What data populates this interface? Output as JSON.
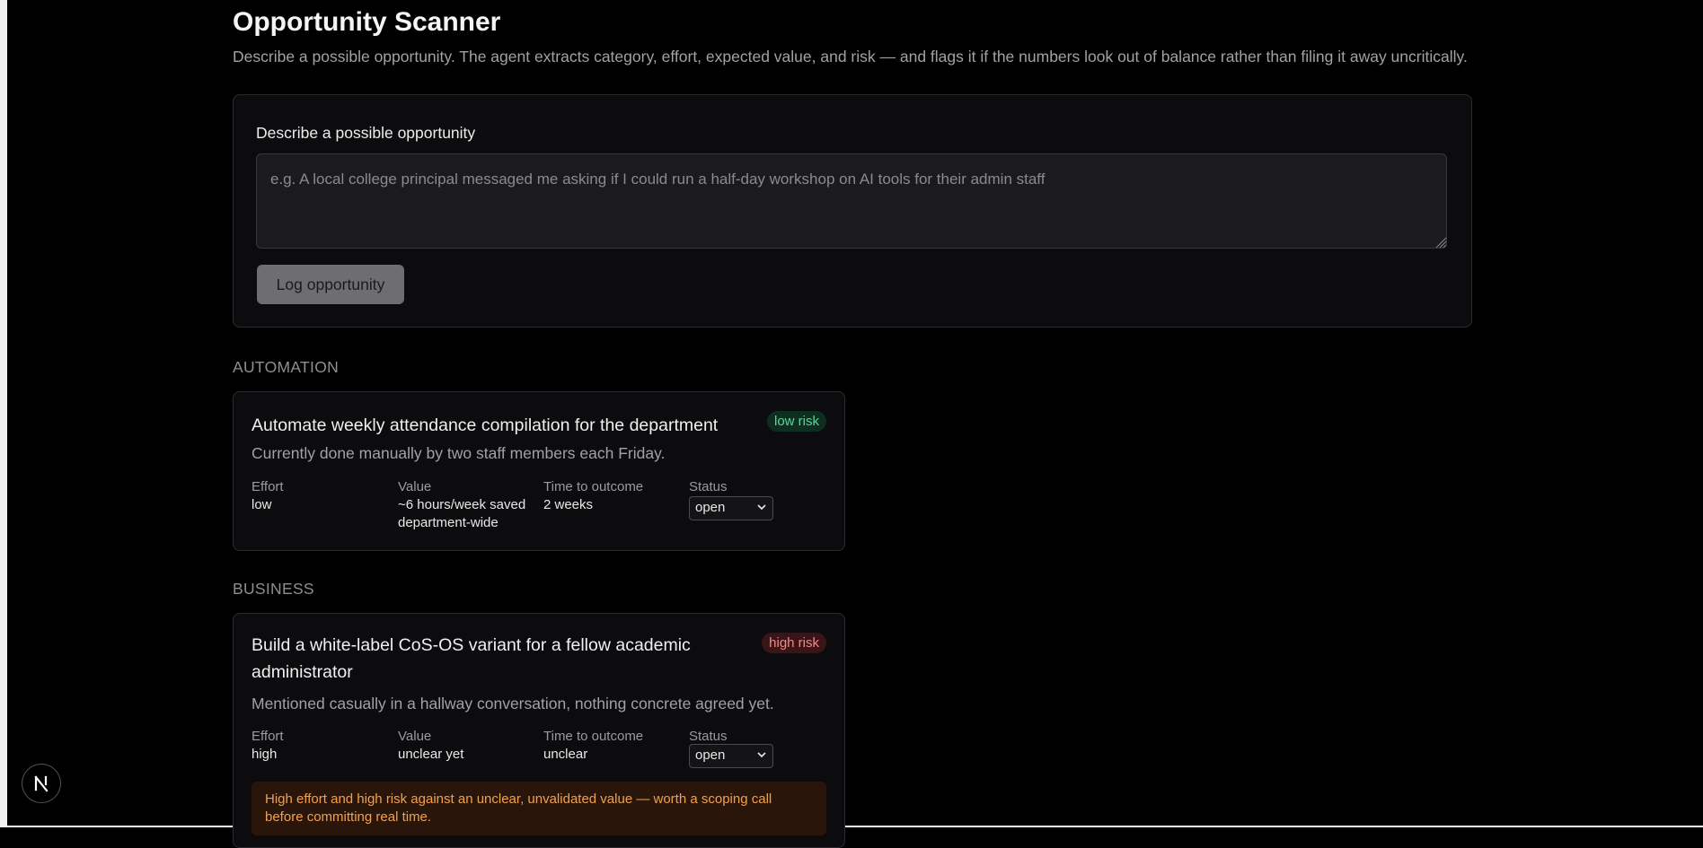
{
  "header": {
    "title": "Opportunity Scanner",
    "subtitle": "Describe a possible opportunity. The agent extracts category, effort, expected value, and risk — and flags it if the numbers look out of balance rather than filing it away uncritically."
  },
  "form": {
    "label": "Describe a possible opportunity",
    "placeholder": "e.g. A local college principal messaged me asking if I could run a half-day workshop on AI tools for their admin staff",
    "submit_label": "Log opportunity"
  },
  "sections": [
    {
      "title": "AUTOMATION",
      "card": {
        "title_lines": [
          "Automate weekly attendance compilation for the department"
        ],
        "description": "Currently done manually by two staff members each Friday.",
        "risk": "low risk",
        "effort_label": "Effort",
        "effort": "low",
        "value_label": "Value",
        "value_lines": [
          "~6 hours/week saved",
          "department-wide"
        ],
        "time_label": "Time to outcome",
        "time": "2 weeks",
        "status_label": "Status",
        "status": "open"
      }
    },
    {
      "title": "BUSINESS",
      "card": {
        "title_lines": [
          "Build a white-label CoS-OS variant for a fellow academic",
          "administrator"
        ],
        "description": "Mentioned casually in a hallway conversation, nothing concrete agreed yet.",
        "risk": "high risk",
        "effort_label": "Effort",
        "effort": "high",
        "value_label": "Value",
        "value_lines": [
          "unclear yet"
        ],
        "time_label": "Time to outcome",
        "time": "unclear",
        "status_label": "Status",
        "status": "open",
        "warning_lines": [
          "High effort and high risk against an unclear, unvalidated value — worth a scoping call",
          "before committing real time."
        ]
      }
    }
  ],
  "icons": {
    "resize_grip": "resize-grip-icon",
    "chevron": "chevron-down-icon",
    "nextjs": "nextjs-logo-icon"
  },
  "colors": {
    "background": "#000000",
    "low_risk": "#5fd39b",
    "high_risk": "#f08a8a",
    "warning_text": "#f0a24a"
  }
}
